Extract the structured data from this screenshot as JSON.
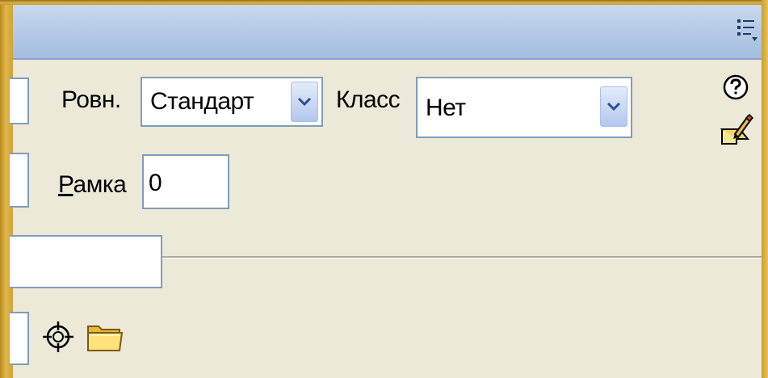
{
  "properties_panel": {
    "align_label": "Ровн.",
    "align_value": "Стандарт",
    "class_label": "Класс",
    "class_value": "Нет",
    "border_label_accel": "Р",
    "border_label_rest": "амка",
    "border_value": "0"
  },
  "icons": {
    "options_menu": "options-menu-icon",
    "help": "help-icon",
    "edit": "edit-icon",
    "point_to_file": "point-to-file-icon",
    "browse_folder": "folder-icon",
    "dropdown_arrow": "chevron-down-icon"
  },
  "colors": {
    "panel_background": "#ece9d8",
    "titlebar": "#b3c9e6",
    "field_border": "#7f9db9",
    "frame_gold": "#d1a23a"
  }
}
